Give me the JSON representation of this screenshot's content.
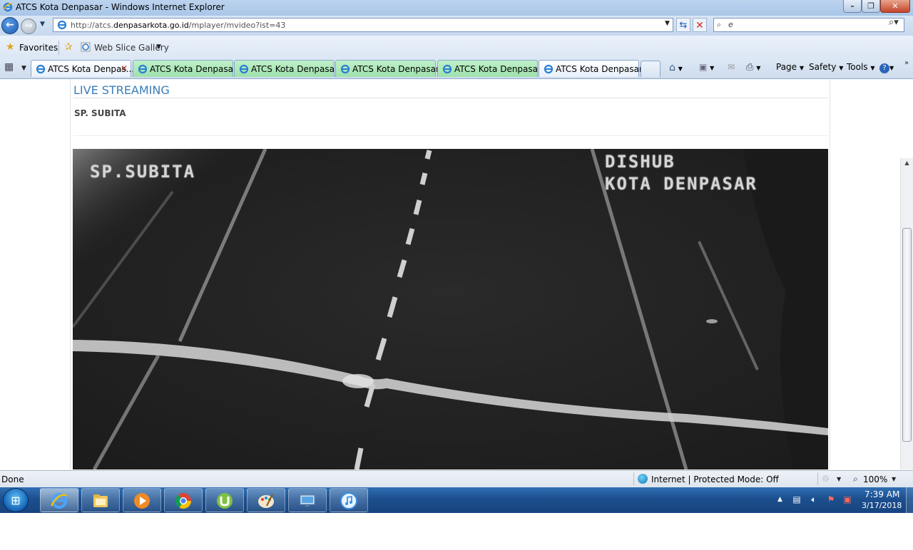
{
  "window": {
    "title": "ATCS Kota Denpasar - Windows Internet Explorer"
  },
  "nav": {
    "url_prefix": "http://atcs.",
    "url_domain": "denpasarkota.go.id",
    "url_path": "/mplayer/mvideo?ist=43",
    "search_value": "e"
  },
  "favorites": {
    "label": "Favorites",
    "web_slice_label": "Web Slice Gallery"
  },
  "tabs": [
    {
      "label": "ATCS Kota Denpas...",
      "active": true
    },
    {
      "label": "ATCS Kota Denpasar",
      "active": false
    },
    {
      "label": "ATCS Kota Denpasar",
      "active": false
    },
    {
      "label": "ATCS Kota Denpasar",
      "active": false
    },
    {
      "label": "ATCS Kota Denpasar",
      "active": false
    },
    {
      "label": "ATCS Kota Denpasar",
      "active": false
    }
  ],
  "command_bar": {
    "page": "Page",
    "safety": "Safety",
    "tools": "Tools"
  },
  "page": {
    "heading": "LIVE STREAMING",
    "location": "SP. SUBITA"
  },
  "video": {
    "overlay_location": "SP.SUBITA",
    "overlay_org_line1": "DISHUB",
    "overlay_org_line2": "KOTA DENPASAR"
  },
  "status": {
    "text": "Done",
    "zone": "Internet | Protected Mode: Off",
    "zoom": "100%"
  },
  "taskbar": {
    "apps": [
      "internet-explorer",
      "file-explorer",
      "media-player",
      "chrome",
      "utorrent",
      "paint",
      "remote-desktop",
      "itunes"
    ],
    "clock_time": "7:39 AM",
    "clock_date": "3/17/2018"
  },
  "colors": {
    "heading": "#3a7db8",
    "active_tab": "#ffffff",
    "inactive_tab": "#a8e6b6"
  }
}
